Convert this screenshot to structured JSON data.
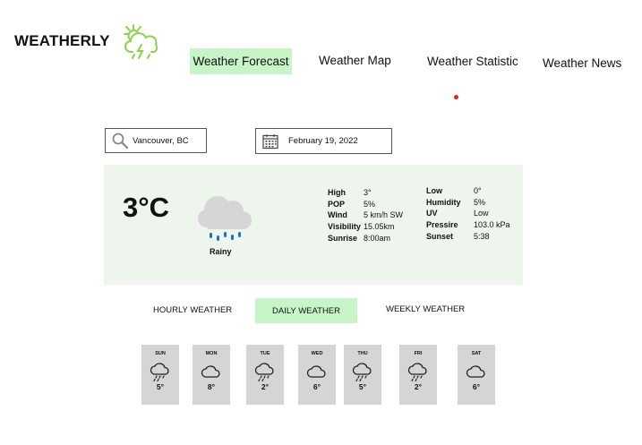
{
  "app": {
    "title": "WEATHERLY",
    "logo_icon": "thunder-cloud-icon"
  },
  "nav": {
    "items": [
      {
        "label": "Weather Forecast",
        "active": true
      },
      {
        "label": "Weather Map"
      },
      {
        "label": "Weather Statistic"
      },
      {
        "label": "Weather News"
      }
    ]
  },
  "search": {
    "value": "Vancouver, BC",
    "icon": "search-icon"
  },
  "date_picker": {
    "value": "February 19, 2022",
    "icon": "calendar-icon"
  },
  "current": {
    "temperature": "3°C",
    "condition": "Rainy",
    "condition_icon": "rain-cloud-icon",
    "details_left": [
      {
        "label": "High",
        "value": "3°"
      },
      {
        "label": "POP",
        "value": "5%"
      },
      {
        "label": "Wind",
        "value": "5 km/h SW"
      },
      {
        "label": "Visibility",
        "value": "15.05km"
      },
      {
        "label": "Sunrise",
        "value": "8:00am"
      }
    ],
    "details_right": [
      {
        "label": "Low",
        "value": "0°"
      },
      {
        "label": "Humidity",
        "value": "5%"
      },
      {
        "label": "UV",
        "value": "Low"
      },
      {
        "label": "Pressire",
        "value": "103.0 kPa"
      },
      {
        "label": "Sunset",
        "value": "5:38"
      }
    ]
  },
  "tabs": [
    {
      "label": "HOURLY WEATHER"
    },
    {
      "label": "DAILY WEATHER",
      "active": true
    },
    {
      "label": "WEEKLY WEATHER"
    }
  ],
  "forecast": [
    {
      "day": "SUN",
      "temp": "5°",
      "icon": "rain-cloud-icon"
    },
    {
      "day": "MON",
      "temp": "8°",
      "icon": "cloud-icon"
    },
    {
      "day": "TUE",
      "temp": "2°",
      "icon": "rain-cloud-icon"
    },
    {
      "day": "WED",
      "temp": "6°",
      "icon": "cloud-icon"
    },
    {
      "day": "THU",
      "temp": "5°",
      "icon": "rain-cloud-icon"
    },
    {
      "day": "FRI",
      "temp": "2°",
      "icon": "rain-cloud-icon"
    },
    {
      "day": "SAT",
      "temp": "6°",
      "icon": "cloud-icon"
    }
  ],
  "colors": {
    "active_tab": "#c7f5c7",
    "panel_bg": "#eef5ec",
    "day_card_bg": "#d5d5d5",
    "rain_drops": "#1e6fc9",
    "logo_green": "#8fd14f",
    "indicator_dot": "#e0221e"
  }
}
